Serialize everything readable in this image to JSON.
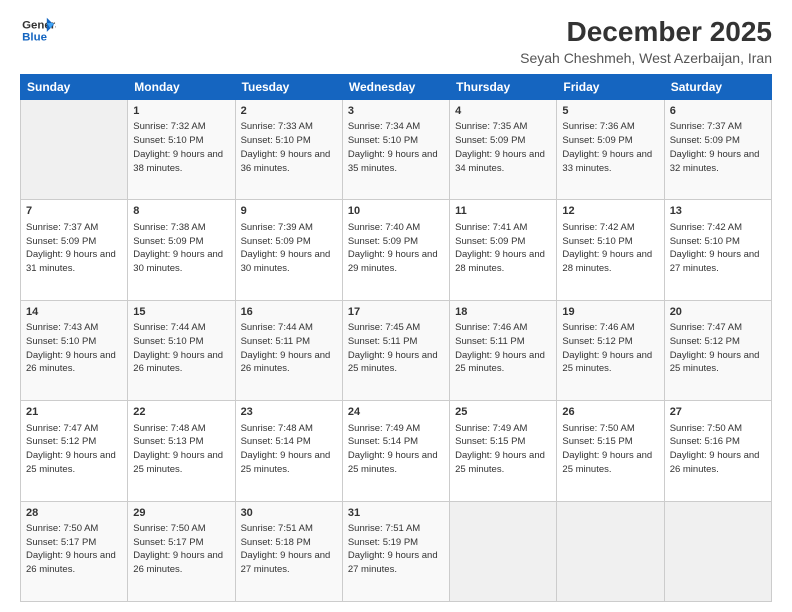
{
  "logo": {
    "line1": "General",
    "line2": "Blue"
  },
  "title": "December 2025",
  "subtitle": "Seyah Cheshmeh, West Azerbaijan, Iran",
  "days_header": [
    "Sunday",
    "Monday",
    "Tuesday",
    "Wednesday",
    "Thursday",
    "Friday",
    "Saturday"
  ],
  "weeks": [
    [
      {
        "num": "",
        "empty": true
      },
      {
        "num": "1",
        "sr": "7:32 AM",
        "ss": "5:10 PM",
        "dl": "9 hours and 38 minutes."
      },
      {
        "num": "2",
        "sr": "7:33 AM",
        "ss": "5:10 PM",
        "dl": "9 hours and 36 minutes."
      },
      {
        "num": "3",
        "sr": "7:34 AM",
        "ss": "5:10 PM",
        "dl": "9 hours and 35 minutes."
      },
      {
        "num": "4",
        "sr": "7:35 AM",
        "ss": "5:09 PM",
        "dl": "9 hours and 34 minutes."
      },
      {
        "num": "5",
        "sr": "7:36 AM",
        "ss": "5:09 PM",
        "dl": "9 hours and 33 minutes."
      },
      {
        "num": "6",
        "sr": "7:37 AM",
        "ss": "5:09 PM",
        "dl": "9 hours and 32 minutes."
      }
    ],
    [
      {
        "num": "7",
        "sr": "7:37 AM",
        "ss": "5:09 PM",
        "dl": "9 hours and 31 minutes."
      },
      {
        "num": "8",
        "sr": "7:38 AM",
        "ss": "5:09 PM",
        "dl": "9 hours and 30 minutes."
      },
      {
        "num": "9",
        "sr": "7:39 AM",
        "ss": "5:09 PM",
        "dl": "9 hours and 30 minutes."
      },
      {
        "num": "10",
        "sr": "7:40 AM",
        "ss": "5:09 PM",
        "dl": "9 hours and 29 minutes."
      },
      {
        "num": "11",
        "sr": "7:41 AM",
        "ss": "5:09 PM",
        "dl": "9 hours and 28 minutes."
      },
      {
        "num": "12",
        "sr": "7:42 AM",
        "ss": "5:10 PM",
        "dl": "9 hours and 28 minutes."
      },
      {
        "num": "13",
        "sr": "7:42 AM",
        "ss": "5:10 PM",
        "dl": "9 hours and 27 minutes."
      }
    ],
    [
      {
        "num": "14",
        "sr": "7:43 AM",
        "ss": "5:10 PM",
        "dl": "9 hours and 26 minutes."
      },
      {
        "num": "15",
        "sr": "7:44 AM",
        "ss": "5:10 PM",
        "dl": "9 hours and 26 minutes."
      },
      {
        "num": "16",
        "sr": "7:44 AM",
        "ss": "5:11 PM",
        "dl": "9 hours and 26 minutes."
      },
      {
        "num": "17",
        "sr": "7:45 AM",
        "ss": "5:11 PM",
        "dl": "9 hours and 25 minutes."
      },
      {
        "num": "18",
        "sr": "7:46 AM",
        "ss": "5:11 PM",
        "dl": "9 hours and 25 minutes."
      },
      {
        "num": "19",
        "sr": "7:46 AM",
        "ss": "5:12 PM",
        "dl": "9 hours and 25 minutes."
      },
      {
        "num": "20",
        "sr": "7:47 AM",
        "ss": "5:12 PM",
        "dl": "9 hours and 25 minutes."
      }
    ],
    [
      {
        "num": "21",
        "sr": "7:47 AM",
        "ss": "5:12 PM",
        "dl": "9 hours and 25 minutes."
      },
      {
        "num": "22",
        "sr": "7:48 AM",
        "ss": "5:13 PM",
        "dl": "9 hours and 25 minutes."
      },
      {
        "num": "23",
        "sr": "7:48 AM",
        "ss": "5:14 PM",
        "dl": "9 hours and 25 minutes."
      },
      {
        "num": "24",
        "sr": "7:49 AM",
        "ss": "5:14 PM",
        "dl": "9 hours and 25 minutes."
      },
      {
        "num": "25",
        "sr": "7:49 AM",
        "ss": "5:15 PM",
        "dl": "9 hours and 25 minutes."
      },
      {
        "num": "26",
        "sr": "7:50 AM",
        "ss": "5:15 PM",
        "dl": "9 hours and 25 minutes."
      },
      {
        "num": "27",
        "sr": "7:50 AM",
        "ss": "5:16 PM",
        "dl": "9 hours and 26 minutes."
      }
    ],
    [
      {
        "num": "28",
        "sr": "7:50 AM",
        "ss": "5:17 PM",
        "dl": "9 hours and 26 minutes."
      },
      {
        "num": "29",
        "sr": "7:50 AM",
        "ss": "5:17 PM",
        "dl": "9 hours and 26 minutes."
      },
      {
        "num": "30",
        "sr": "7:51 AM",
        "ss": "5:18 PM",
        "dl": "9 hours and 27 minutes."
      },
      {
        "num": "31",
        "sr": "7:51 AM",
        "ss": "5:19 PM",
        "dl": "9 hours and 27 minutes."
      },
      {
        "num": "",
        "empty": true
      },
      {
        "num": "",
        "empty": true
      },
      {
        "num": "",
        "empty": true
      }
    ]
  ]
}
